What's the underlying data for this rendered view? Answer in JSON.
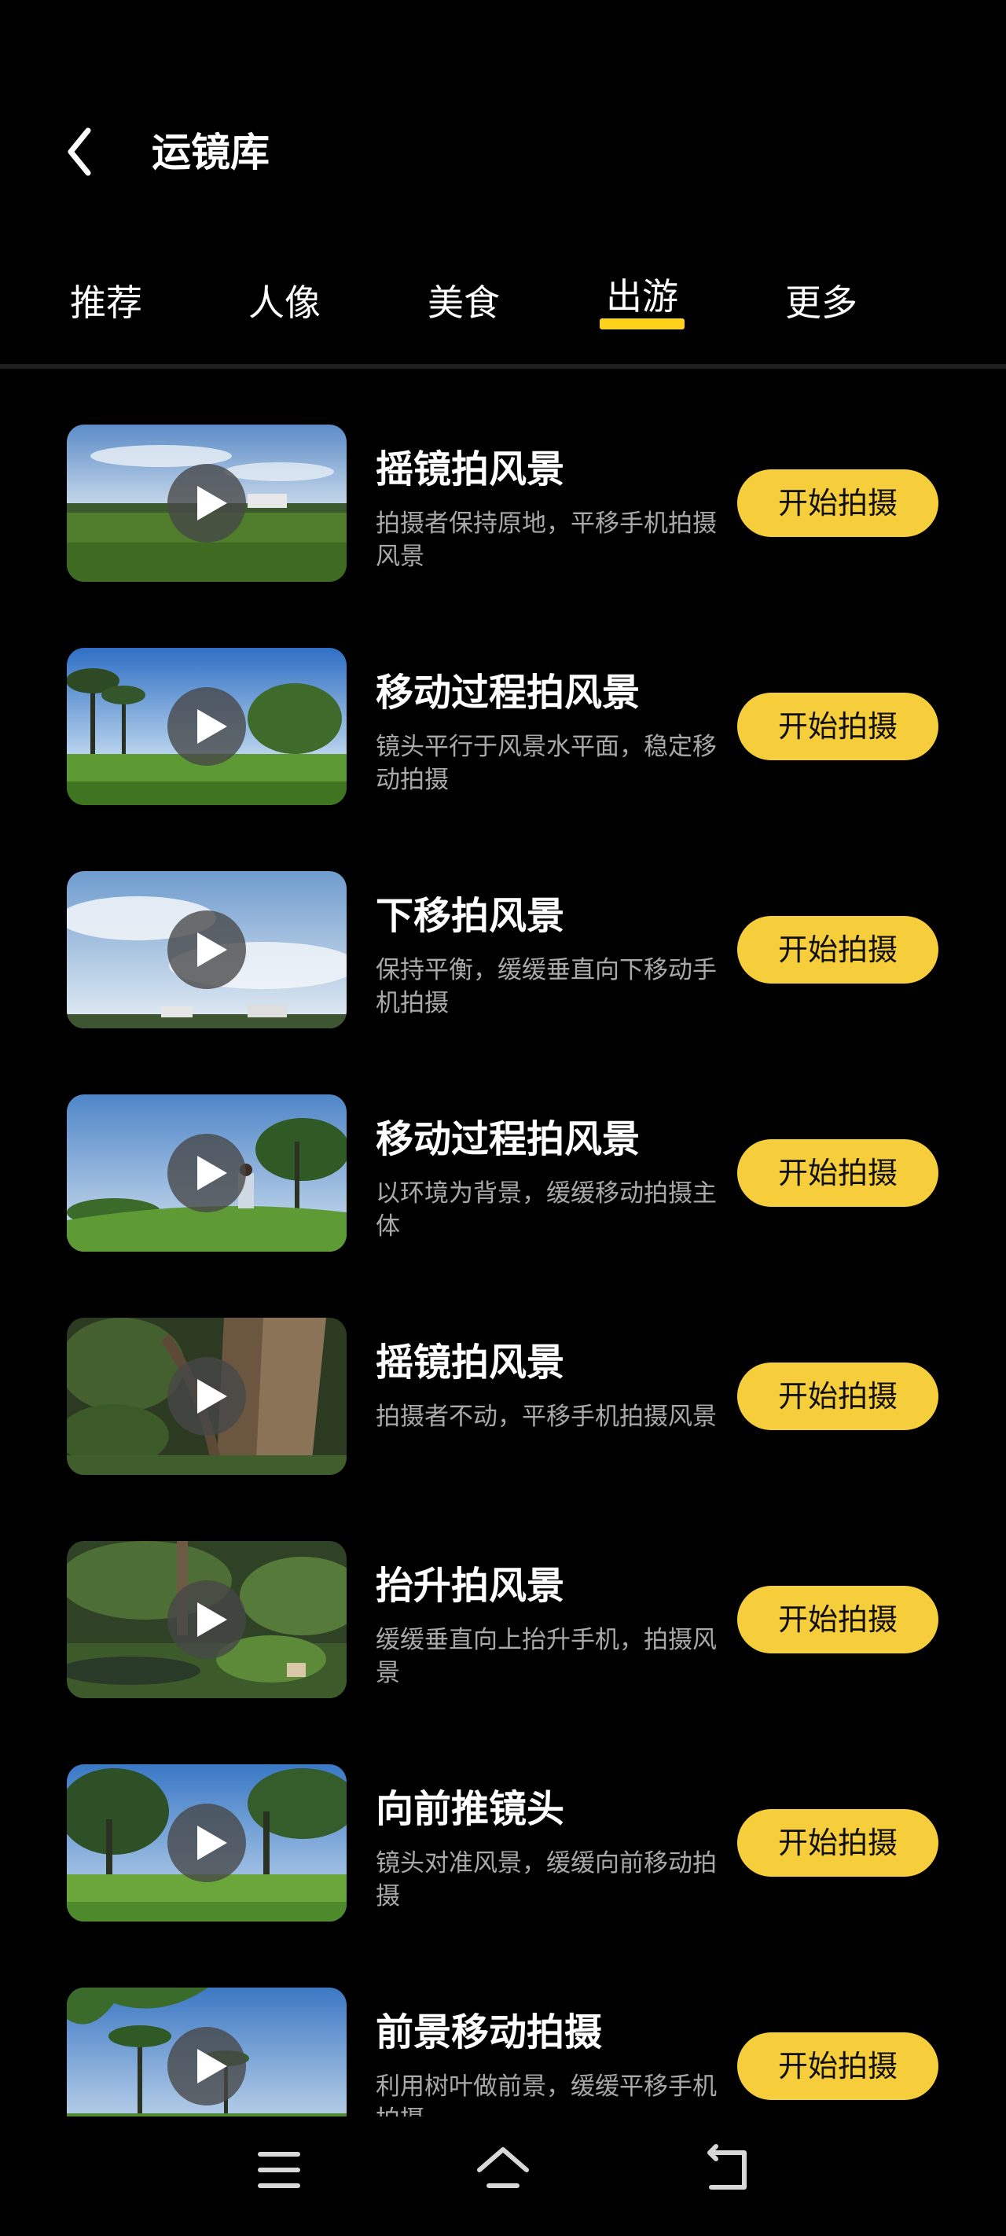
{
  "header": {
    "title": "运镜库"
  },
  "tabs": [
    {
      "label": "推荐"
    },
    {
      "label": "人像"
    },
    {
      "label": "美食"
    },
    {
      "label": "出游"
    },
    {
      "label": "更多"
    }
  ],
  "active_tab": "出游",
  "accent_color": "#ffd21a",
  "button_color": "#f6cd3a",
  "items": [
    {
      "title": "摇镜拍风景",
      "desc": "拍摄者保持原地，平移手机拍摄风景",
      "button": "开始拍摄",
      "thumb_icon": "play-icon"
    },
    {
      "title": "移动过程拍风景",
      "desc": "镜头平行于风景水平面，稳定移动拍摄",
      "button": "开始拍摄",
      "thumb_icon": "play-icon"
    },
    {
      "title": "下移拍风景",
      "desc": "保持平衡，缓缓垂直向下移动手机拍摄",
      "button": "开始拍摄",
      "thumb_icon": "play-icon"
    },
    {
      "title": "移动过程拍风景",
      "desc": "以环境为背景，缓缓移动拍摄主体",
      "button": "开始拍摄",
      "thumb_icon": "play-icon"
    },
    {
      "title": "摇镜拍风景",
      "desc": "拍摄者不动，平移手机拍摄风景",
      "button": "开始拍摄",
      "thumb_icon": "play-icon"
    },
    {
      "title": "抬升拍风景",
      "desc": "缓缓垂直向上抬升手机，拍摄风景",
      "button": "开始拍摄",
      "thumb_icon": "play-icon"
    },
    {
      "title": "向前推镜头",
      "desc": "镜头对准风景，缓缓向前移动拍摄",
      "button": "开始拍摄",
      "thumb_icon": "play-icon"
    },
    {
      "title": "前景移动拍摄",
      "desc": "利用树叶做前景，缓缓平移手机拍摄",
      "button": "开始拍摄",
      "thumb_icon": "play-icon"
    }
  ],
  "bottom_nav": {
    "icons": [
      "menu-icon",
      "home-icon",
      "back-icon"
    ]
  }
}
